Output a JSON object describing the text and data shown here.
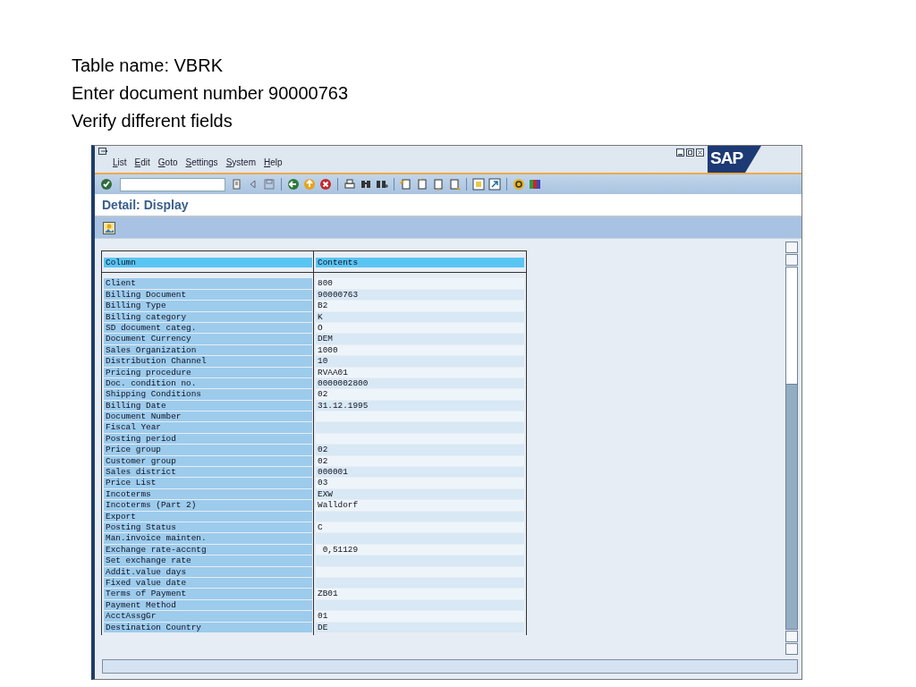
{
  "slide_lines": [
    "Table name: VBRK",
    "Enter document number 90000763",
    "Verify different fields"
  ],
  "window": {
    "menu": [
      "List",
      "Edit",
      "Goto",
      "Settings",
      "System",
      "Help"
    ],
    "logo": "SAP",
    "title": "Detail: Display"
  },
  "table": {
    "columns": [
      "Column",
      "Contents"
    ],
    "rows": [
      {
        "column": "Client",
        "contents": "800"
      },
      {
        "column": "Billing Document",
        "contents": "90000763"
      },
      {
        "column": "Billing Type",
        "contents": "B2"
      },
      {
        "column": "Billing category",
        "contents": "K"
      },
      {
        "column": "SD document categ.",
        "contents": "O"
      },
      {
        "column": "Document Currency",
        "contents": "DEM"
      },
      {
        "column": "Sales Organization",
        "contents": "1000"
      },
      {
        "column": "Distribution Channel",
        "contents": "10"
      },
      {
        "column": "Pricing procedure",
        "contents": "RVAA01"
      },
      {
        "column": "Doc. condition no.",
        "contents": "0000002800"
      },
      {
        "column": "Shipping Conditions",
        "contents": "02"
      },
      {
        "column": "Billing Date",
        "contents": "31.12.1995"
      },
      {
        "column": "Document Number"
      },
      {
        "column": "Fiscal Year"
      },
      {
        "column": "Posting period"
      },
      {
        "column": "Price group",
        "contents": "02"
      },
      {
        "column": "Customer group",
        "contents": "02"
      },
      {
        "column": "Sales district",
        "contents": "000001"
      },
      {
        "column": "Price List",
        "contents": "03"
      },
      {
        "column": "Incoterms",
        "contents": "EXW"
      },
      {
        "column": "Incoterms (Part 2)",
        "contents": "Walldorf"
      },
      {
        "column": "Export"
      },
      {
        "column": "Posting Status",
        "contents": "C"
      },
      {
        "column": "Man.invoice mainten."
      },
      {
        "column": "Exchange rate-accntg",
        "contents": " 0,51129"
      },
      {
        "column": "Set exchange rate"
      },
      {
        "column": "Addit.value days"
      },
      {
        "column": "Fixed value date"
      },
      {
        "column": "Terms of Payment",
        "contents": "ZB01"
      },
      {
        "column": "Payment Method"
      },
      {
        "column": "AcctAssgGr",
        "contents": "01"
      },
      {
        "column": "Destination Country",
        "contents": "DE"
      }
    ]
  }
}
